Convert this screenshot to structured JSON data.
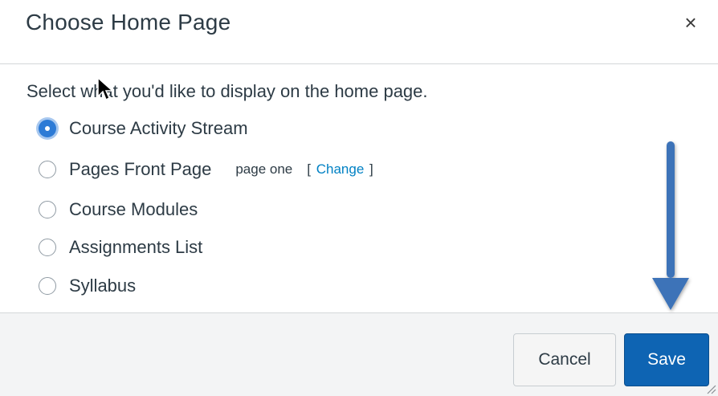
{
  "dialog": {
    "title": "Choose Home Page",
    "close_icon": "×",
    "prompt": "Select what you'd like to display on the home page.",
    "options": [
      {
        "label": "Course Activity Stream",
        "checked": true
      },
      {
        "label": "Pages Front Page",
        "checked": false,
        "sub_label": "page one",
        "link_open": "[",
        "link_label": "Change",
        "link_close": "]"
      },
      {
        "label": "Course Modules",
        "checked": false
      },
      {
        "label": "Assignments List",
        "checked": false
      },
      {
        "label": "Syllabus",
        "checked": false
      }
    ],
    "buttons": {
      "cancel": "Cancel",
      "save": "Save"
    }
  },
  "colors": {
    "accent_blue": "#0e64b3",
    "radio_checked": "#2d7bd6",
    "link": "#0081c4",
    "annotation_arrow": "#3d73b8"
  },
  "icons": [
    "close-icon",
    "radio-checked-icon",
    "radio-unchecked-icon",
    "resize-grip-icon",
    "mouse-cursor-icon",
    "down-arrow-annotation-icon"
  ]
}
